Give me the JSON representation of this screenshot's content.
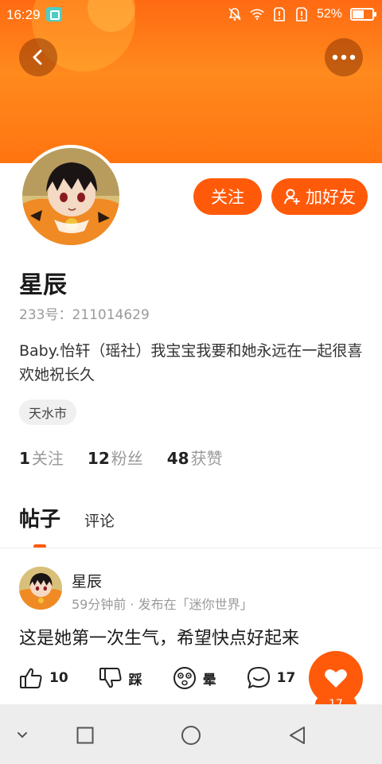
{
  "status_bar": {
    "time": "16:29",
    "battery_percent": "52%",
    "battery_level": 0.52
  },
  "header": {
    "back_icon": "chevron-left-icon",
    "more_icon": "more-horizontal-icon",
    "accent_color": "#ff5a0a"
  },
  "profile": {
    "username": "星辰",
    "id_text": "233号：211014629",
    "bio": "Baby.怡轩（瑶社）我宝宝我要和她永远在一起很喜欢她祝长久",
    "location": "天水市",
    "follow_label": "关注",
    "add_friend_label": "加好友",
    "stats": [
      {
        "num": "1",
        "label": "关注"
      },
      {
        "num": "12",
        "label": "粉丝"
      },
      {
        "num": "48",
        "label": "获赞"
      }
    ]
  },
  "tabs": [
    {
      "label": "帖子",
      "active": true
    },
    {
      "label": "评论",
      "active": false
    }
  ],
  "post": {
    "author": "星辰",
    "meta": "59分钟前 · 发布在「迷你世界」",
    "text": "这是她第一次生气，希望快点好起来",
    "actions": [
      {
        "icon": "thumbs-up-icon",
        "label": "10"
      },
      {
        "icon": "thumbs-down-icon",
        "label": "踩"
      },
      {
        "icon": "dizzy-face-icon",
        "label": "晕"
      },
      {
        "icon": "comment-icon",
        "label": "17"
      }
    ],
    "like_count": "17"
  }
}
